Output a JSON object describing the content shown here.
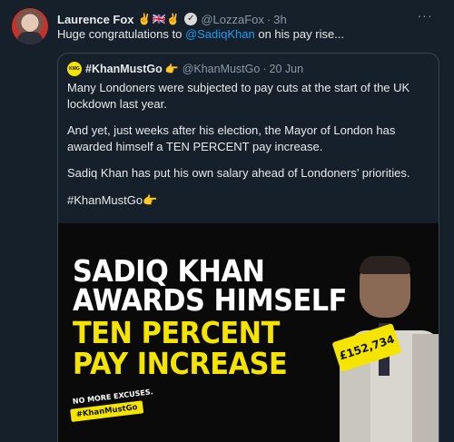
{
  "author": {
    "name": "Laurence Fox",
    "emoji": "✌️🇬🇧✌️",
    "verified_glyph": "✓",
    "handle": "@LozzaFox",
    "separator": "·",
    "time": "3h",
    "more_glyph": "···"
  },
  "tweet": {
    "text_prefix": "Huge congratulations to ",
    "mention": "@SadiqKhan",
    "text_suffix": " on his pay rise..."
  },
  "quoted": {
    "avatar_text": "KMG",
    "name": "#KhanMustGo",
    "point_emoji": "👉",
    "handle": "@KhanMustGo",
    "separator": "·",
    "time": "20 Jun",
    "paragraphs": [
      "Many Londoners were subjected to pay cuts at the start of the UK lockdown last year.",
      "And yet, just weeks after his election, the Mayor of London has awarded himself a TEN PERCENT pay increase.",
      "Sadiq Khan has put his own salary ahead of Londoners’ priorities.",
      "#KhanMustGo👉"
    ],
    "media": {
      "headline_lines": [
        "SADIQ KHAN",
        "AWARDS HIMSELF",
        "TEN PERCENT",
        "PAY INCREASE"
      ],
      "price_tag": "£152,734",
      "no_excuses": "NO MORE EXCUSES.",
      "hashtag_badge": "#KhanMustGo",
      "colors": {
        "highlight": "#f4e400",
        "white": "#ffffff",
        "background": "#0a0a0a"
      }
    }
  },
  "colors": {
    "background": "#15202b",
    "text": "#e7e9ea",
    "muted": "#8b98a5",
    "link": "#1d9bf0",
    "border": "#38444d"
  }
}
